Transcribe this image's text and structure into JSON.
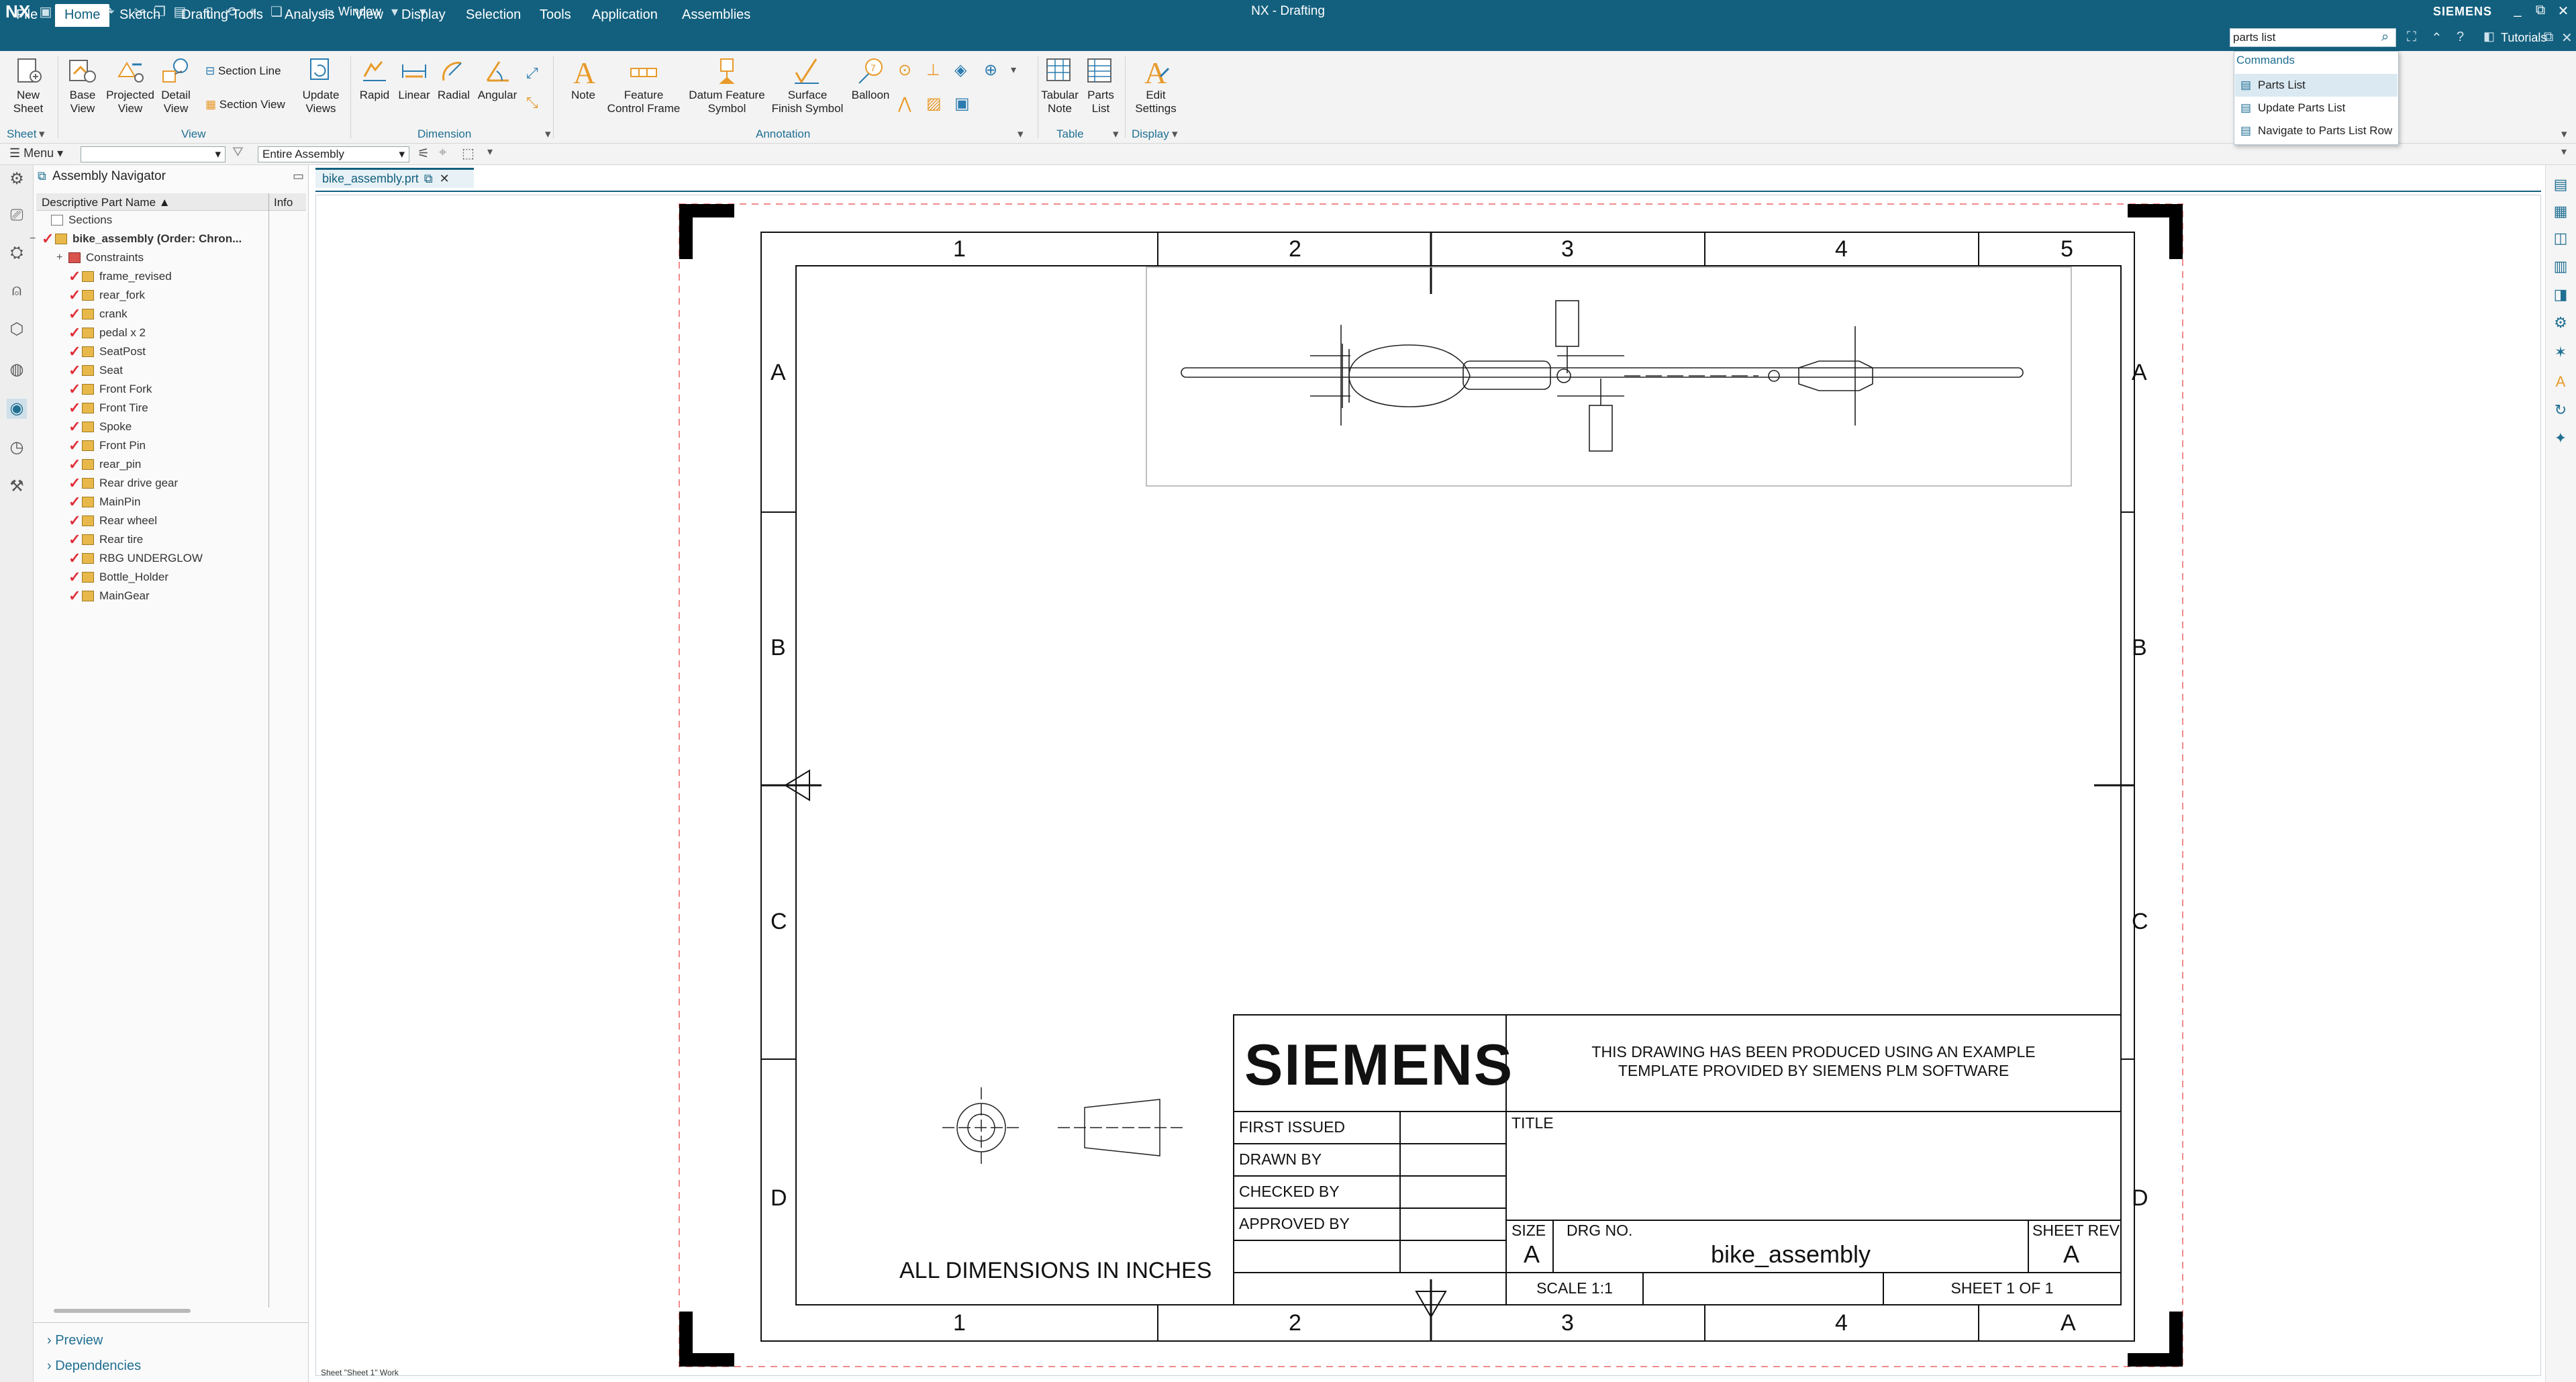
{
  "app": {
    "logo": "NX",
    "window_title": "NX - Drafting",
    "brand": "SIEMENS",
    "window_menu": "Window",
    "tutorials": "Tutorials"
  },
  "colors": {
    "titlebar": "#13607e",
    "accent": "#1f6f92",
    "check": "#e0303a"
  },
  "menu": {
    "tabs": [
      "File",
      "Home",
      "Sketch",
      "Drafting Tools",
      "Analysis",
      "View",
      "Display",
      "Selection",
      "Tools",
      "Application",
      "Assemblies"
    ],
    "active": "Home"
  },
  "search": {
    "value": "parts list",
    "heading": "Commands",
    "results": [
      "Parts List",
      "Update Parts List",
      "Navigate to Parts List Row"
    ]
  },
  "ribbon": {
    "new_sheet": [
      "New",
      "Sheet"
    ],
    "base_view": [
      "Base",
      "View"
    ],
    "projected_view": [
      "Projected",
      "View"
    ],
    "detail_view": [
      "Detail",
      "View"
    ],
    "section_line": "Section Line",
    "section_view": "Section View",
    "update_views": [
      "Update",
      "Views"
    ],
    "rapid": "Rapid",
    "linear": "Linear",
    "radial": "Radial",
    "angular": "Angular",
    "note": "Note",
    "feature_control_frame": [
      "Feature",
      "Control Frame"
    ],
    "datum_feature_symbol": [
      "Datum Feature",
      "Symbol"
    ],
    "surface_finish_symbol": [
      "Surface",
      "Finish Symbol"
    ],
    "balloon": "Balloon",
    "tabular_note": [
      "Tabular",
      "Note"
    ],
    "parts_list": [
      "Parts",
      "List"
    ],
    "edit_settings": [
      "Edit",
      "Settings"
    ],
    "groups": {
      "sheet": "Sheet",
      "view": "View",
      "dimension": "Dimension",
      "annotation": "Annotation",
      "table": "Table",
      "display": "Display"
    }
  },
  "toolbar2": {
    "menu": "Menu",
    "filter": "",
    "scope": "Entire Assembly"
  },
  "navigator": {
    "title": "Assembly Navigator",
    "columns": [
      "Descriptive Part Name",
      "Info"
    ],
    "sections": "Sections",
    "root": "bike_assembly (Order: Chron...",
    "constraints": "Constraints",
    "parts": [
      "frame_revised",
      "rear_fork",
      "crank",
      "pedal x 2",
      "SeatPost",
      "Seat",
      "Front Fork",
      "Front Tire",
      "Spoke",
      "Front Pin",
      "rear_pin",
      "Rear drive gear",
      "MainPin",
      "Rear wheel",
      "Rear tire",
      "RBG UNDERGLOW",
      "Bottle_Holder",
      "MainGear"
    ],
    "footer": [
      "Preview",
      "Dependencies"
    ]
  },
  "document_tab": "bike_assembly.prt",
  "status": "Sheet \"Sheet 1\" Work",
  "drawing": {
    "zone_cols_top": [
      "1",
      "2",
      "3",
      "4",
      "5"
    ],
    "zone_cols_bottom": [
      "1",
      "2",
      "3",
      "4",
      "A"
    ],
    "zone_rows": [
      "A",
      "B",
      "C",
      "D"
    ],
    "note": "ALL DIMENSIONS IN INCHES",
    "title_block": {
      "logo": "SIEMENS",
      "disclaimer_1": "THIS DRAWING HAS BEEN PRODUCED USING AN EXAMPLE",
      "disclaimer_2": "TEMPLATE PROVIDED BY SIEMENS PLM SOFTWARE",
      "first_issued": "FIRST ISSUED",
      "drawn_by": "DRAWN BY",
      "checked_by": "CHECKED BY",
      "approved_by": "APPROVED BY",
      "title": "TITLE",
      "size_label": "SIZE",
      "size": "A",
      "drg_no_label": "DRG NO.",
      "drg_no": "bike_assembly",
      "sheet_rev_label": "SHEET REV",
      "sheet_rev": "A",
      "scale": "SCALE 1:1",
      "sheet": "SHEET 1 OF 1"
    }
  }
}
